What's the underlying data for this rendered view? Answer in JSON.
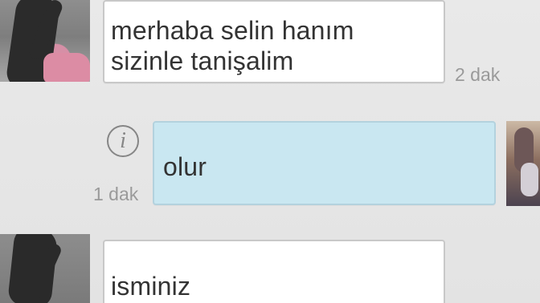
{
  "conversation": {
    "messages": [
      {
        "side": "left",
        "lines": [
          "merhaba selin hanım",
          "sizinle tanişalim"
        ],
        "time": "2 dak"
      },
      {
        "side": "right",
        "lines": [
          "olur"
        ],
        "time": "1 dak",
        "status_icon": "info-icon"
      },
      {
        "side": "left",
        "lines": [
          "isminiz"
        ]
      }
    ]
  },
  "icons": {
    "status": "info-icon"
  },
  "colors": {
    "background": "#e7e7e7",
    "incoming_bubble": "#ffffff",
    "outgoing_bubble": "#c9e7f1",
    "text": "#333333",
    "timestamp": "#9a9a9a"
  }
}
